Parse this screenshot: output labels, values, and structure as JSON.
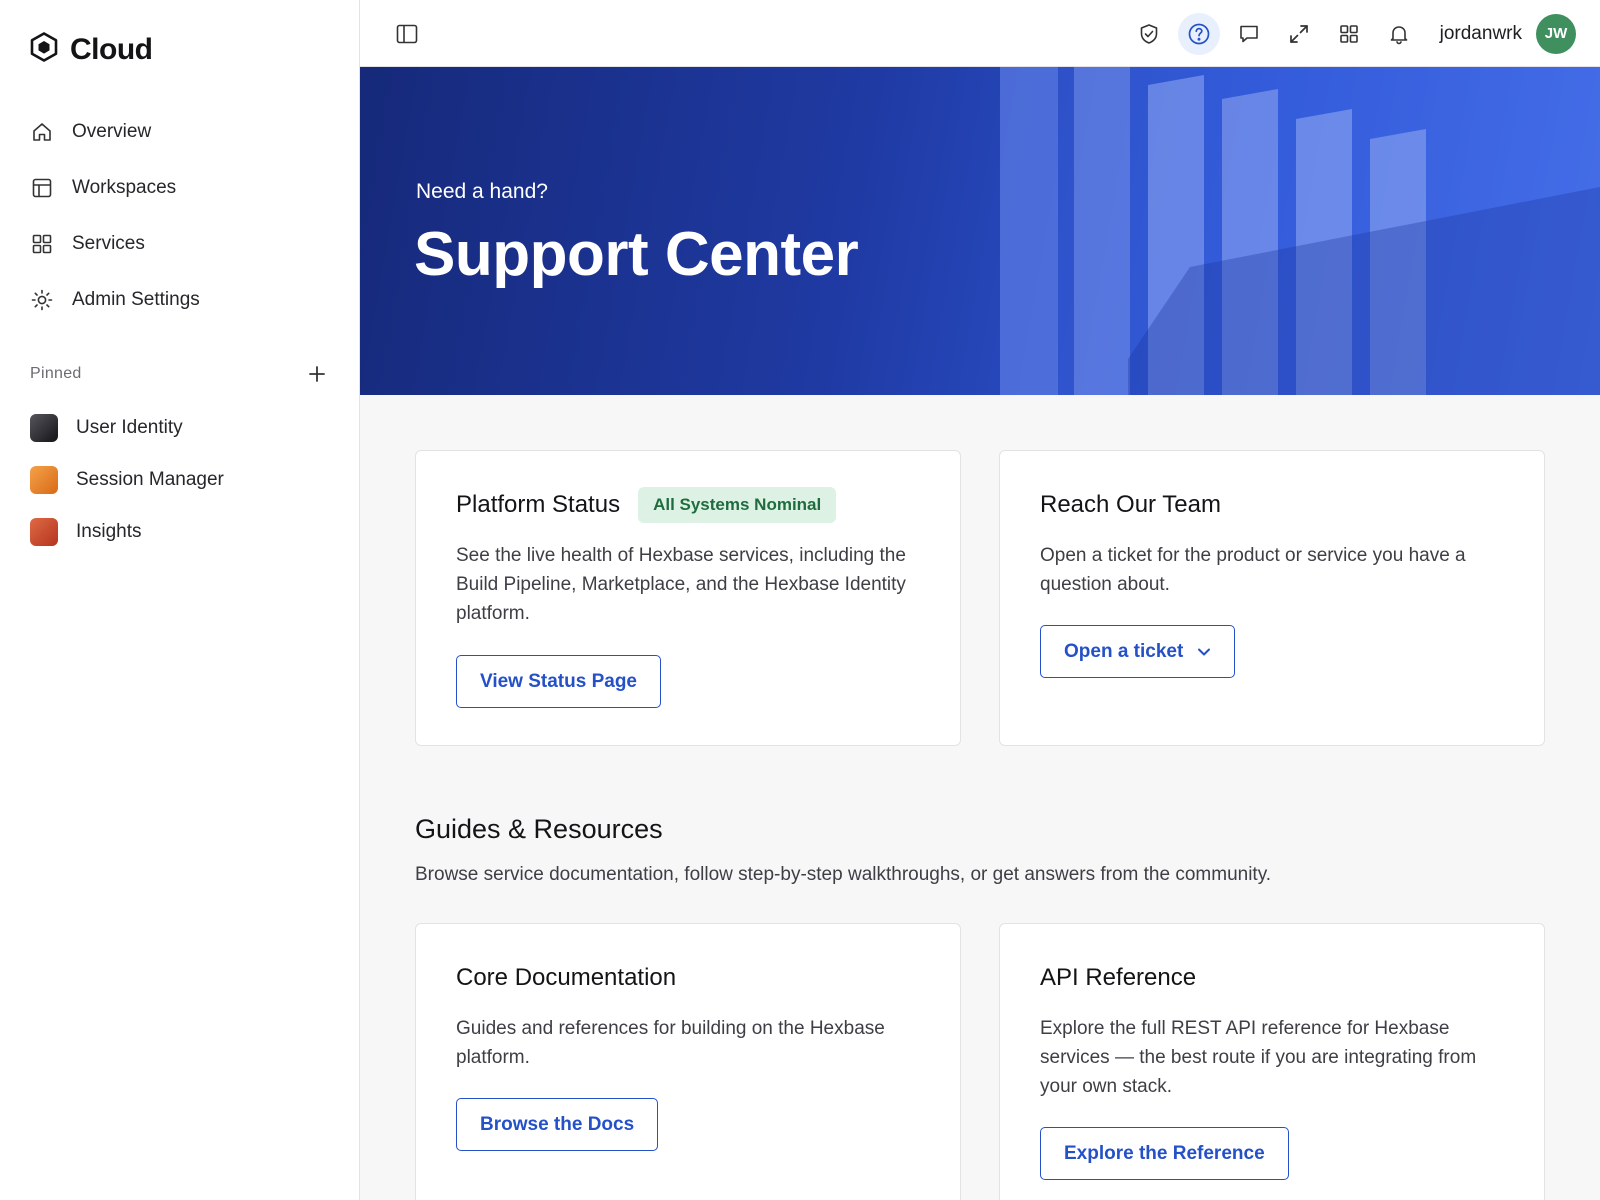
{
  "brand": {
    "name": "Cloud"
  },
  "sidebar": {
    "nav": [
      {
        "label": "Overview",
        "icon": "home-icon"
      },
      {
        "label": "Workspaces",
        "icon": "layout-icon"
      },
      {
        "label": "Services",
        "icon": "grid-icon"
      },
      {
        "label": "Admin Settings",
        "icon": "gear-icon"
      }
    ],
    "pinned_title": "Pinned",
    "pinned": [
      {
        "label": "User Identity",
        "color": "#2a2a2e"
      },
      {
        "label": "Session Manager",
        "color": "#e8862a"
      },
      {
        "label": "Insights",
        "color": "#c8442a"
      }
    ]
  },
  "topbar": {
    "icons": [
      "shield-icon",
      "help-icon",
      "chat-icon",
      "expand-icon",
      "apps-icon",
      "bell-icon"
    ],
    "active_icon": "help-icon",
    "username": "jordanwrk",
    "avatar_initials": "JW",
    "avatar_color": "#3f8f5f"
  },
  "hero": {
    "kicker": "Need a hand?",
    "title": "Support Center"
  },
  "status_card": {
    "title": "Platform Status",
    "badge": "All Systems Nominal",
    "body": "See the live health of Hexbase services, including the Build Pipeline, Marketplace, and the Hexbase Identity platform.",
    "button": "View Status Page"
  },
  "team_card": {
    "title": "Reach Our Team",
    "body": "Open a ticket for the product or service you have a question about.",
    "button": "Open a ticket"
  },
  "guides": {
    "title": "Guides & Resources",
    "subtitle": "Browse service documentation, follow step-by-step walkthroughs, or get answers from the community."
  },
  "docs_card": {
    "title": "Core Documentation",
    "body": "Guides and references for building on the Hexbase platform.",
    "button": "Browse the Docs"
  },
  "api_card": {
    "title": "API Reference",
    "body": "Explore the full REST API reference for Hexbase services — the best route if you are integrating from your own stack.",
    "button": "Explore the Reference"
  },
  "colors": {
    "accent": "#2451c7",
    "hero_start": "#16297a",
    "hero_end": "#4a73ec",
    "badge_bg": "#ddf2e4",
    "badge_text": "#1f6d3f"
  }
}
